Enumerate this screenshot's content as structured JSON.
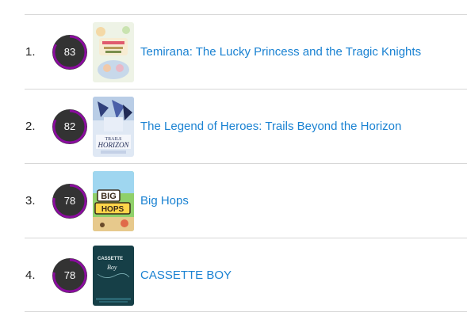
{
  "items": [
    {
      "rank": "1.",
      "score": "83",
      "score_fraction": 0.83,
      "title": "Temirana: The Lucky Princess and the Tragic Knights"
    },
    {
      "rank": "2.",
      "score": "82",
      "score_fraction": 0.82,
      "title": "The Legend of Heroes: Trails Beyond the Horizon"
    },
    {
      "rank": "3.",
      "score": "78",
      "score_fraction": 0.78,
      "title": "Big Hops"
    },
    {
      "rank": "4.",
      "score": "78",
      "score_fraction": 0.78,
      "title": "CASSETTE BOY"
    }
  ],
  "covers": {
    "trails_lettering": "TRAILS HORIZON",
    "bighops_lettering": "BIG HOPS",
    "cassette_lettering": "CASSETTE Boy"
  },
  "colors": {
    "score_ring": "#8a0c9e",
    "score_bg": "#333333",
    "link": "#1a82d2"
  }
}
